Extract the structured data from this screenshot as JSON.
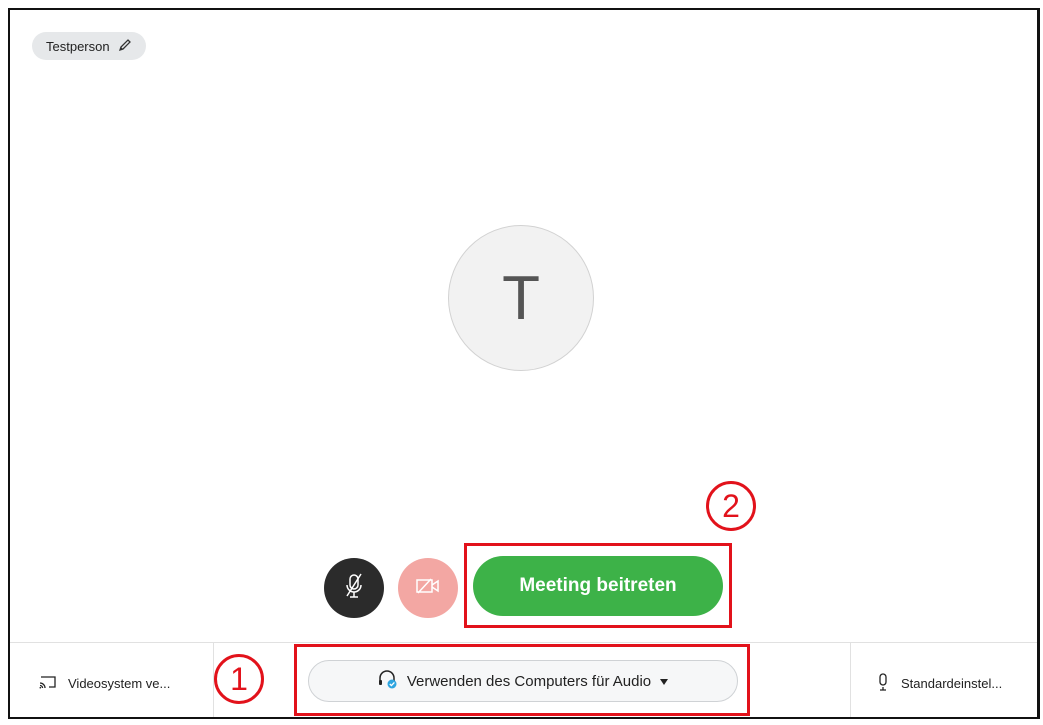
{
  "user": {
    "name": "Testperson",
    "avatar_initial": "T"
  },
  "icons": {
    "edit": "pencil-icon",
    "mute": "microphone-muted-icon",
    "video": "video-off-icon",
    "cast": "cast-icon",
    "headset": "headset-icon",
    "dropdown": "caret-down-icon",
    "microphone": "microphone-icon"
  },
  "controls": {
    "join_label": "Meeting beitreten"
  },
  "bottom_bar": {
    "video_system_label": "Videosystem ve...",
    "audio_option_label": "Verwenden des Computers für Audio",
    "audio_device_label": "Standardeinstel..."
  },
  "annotations": {
    "marker_1": "1",
    "marker_2": "2",
    "color": "#e2121b"
  },
  "colors": {
    "join_green": "#3db248",
    "mute_dark": "#2b2b2b",
    "video_off_pink": "#f3a7a3"
  }
}
